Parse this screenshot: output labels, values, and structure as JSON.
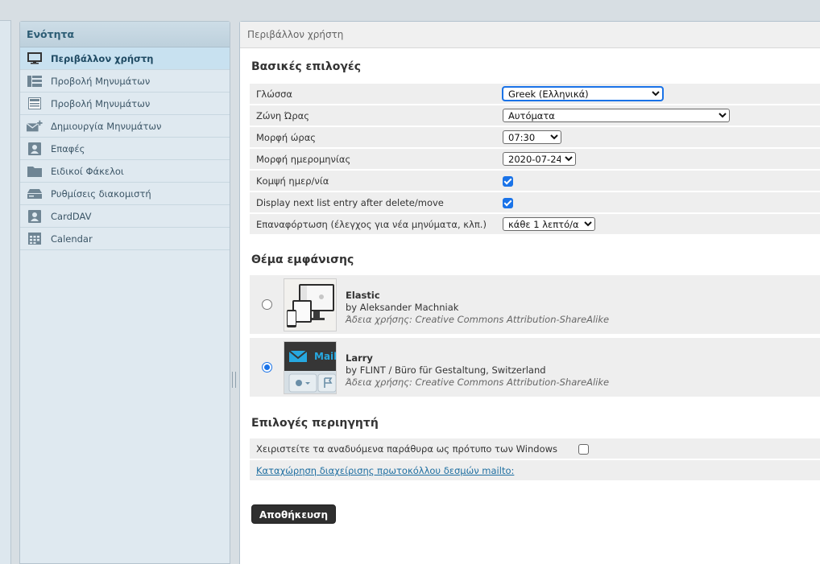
{
  "sections": {
    "header": "Ενότητα",
    "items": [
      {
        "label": "Περιβάλλον χρήστη",
        "icon": "monitor-icon",
        "active": true
      },
      {
        "label": "Προβολή Μηνυμάτων",
        "icon": "list-view-icon"
      },
      {
        "label": "Προβολή Μηνυμάτων",
        "icon": "message-view-icon"
      },
      {
        "label": "Δημιουργία Μηνυμάτων",
        "icon": "compose-icon"
      },
      {
        "label": "Επαφές",
        "icon": "contacts-icon"
      },
      {
        "label": "Ειδικοί Φάκελοι",
        "icon": "folder-icon"
      },
      {
        "label": "Ρυθμίσεις διακομιστή",
        "icon": "server-icon"
      },
      {
        "label": "CardDAV",
        "icon": "carddav-icon"
      },
      {
        "label": "Calendar",
        "icon": "calendar-icon"
      }
    ]
  },
  "content": {
    "title": "Περιβάλλον χρήστη",
    "basic": {
      "legend": "Βασικές επιλογές",
      "language": {
        "label": "Γλώσσα",
        "value": "Greek (Ελληνικά)"
      },
      "timezone": {
        "label": "Ζώνη Ώρας",
        "value": "Αυτόματα"
      },
      "time_format": {
        "label": "Μορφή ώρας",
        "value": "07:30"
      },
      "date_format": {
        "label": "Μορφή ημερομηνίας",
        "value": "2020-07-24"
      },
      "pretty_date": {
        "label": "Κομψή ημερ/νία",
        "checked": true
      },
      "display_next": {
        "label": "Display next list entry after delete/move",
        "checked": true
      },
      "refresh": {
        "label": "Επαναφόρτωση (έλεγχος για νέα μηνύματα, κλπ.)",
        "value": "κάθε 1 λεπτό/α"
      }
    },
    "skin": {
      "legend": "Θέμα εμφάνισης",
      "options": [
        {
          "name": "Elastic",
          "author": "by Aleksander Machniak",
          "license": "Άδεια χρήσης: Creative Commons Attribution-ShareAlike",
          "selected": false
        },
        {
          "name": "Larry",
          "author": "by FLINT / Büro für Gestaltung, Switzerland",
          "license": "Άδεια χρήσης: Creative Commons Attribution-ShareAlike",
          "selected": true
        }
      ],
      "larry_thumb_text": "Mail"
    },
    "browser": {
      "legend": "Επιλογές περιηγητή",
      "popups": {
        "label": "Χειριστείτε τα αναδυόμενα παράθυρα ως πρότυπο των Windows",
        "checked": false
      },
      "mailto_link": "Καταχώρηση διαχείρισης πρωτοκόλλου δεσμών mailto:"
    },
    "save_label": "Αποθήκευση"
  },
  "colors": {
    "accent": "#1a73e8",
    "sidebar_active": "#c8e1f0",
    "button": "#2f2f2f"
  }
}
